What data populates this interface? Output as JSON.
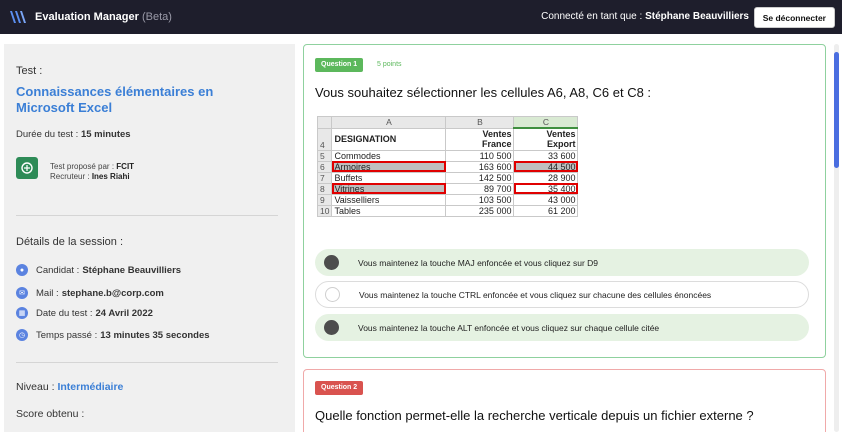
{
  "header": {
    "app_name": "Evaluation Manager",
    "app_beta": "(Beta)",
    "connected_prefix": "Connecté en tant que :",
    "connected_user": "Stéphane Beauvilliers",
    "logout_label": "Se déconnecter",
    "logo_icon": "double-chevron-logo-icon",
    "bg_color": "#1e1e2c"
  },
  "sidebar": {
    "test_label": "Test :",
    "test_title": "Connaissances élémentaires en Microsoft Excel",
    "duration_label": "Durée du test :",
    "duration_value": "15 minutes",
    "proposed_by_label": "Test proposé par :",
    "proposed_by_value": "FCIT",
    "recruiter_label": "Recruteur :",
    "recruiter_value": "Ines Riahi",
    "session_label": "Détails de la session :",
    "candidate_label": "Candidat :",
    "candidate_value": "Stéphane Beauvilliers",
    "mail_label": "Mail :",
    "mail_value": "stephane.b@corp.com",
    "date_label": "Date du test :",
    "date_value": "24 Avril 2022",
    "time_label": "Temps passé :",
    "time_value": "13 minutes 35 secondes",
    "level_label": "Niveau :",
    "level_value": "Intermédiaire",
    "score_label": "Score obtenu :",
    "accent_color": "#3b7fd6"
  },
  "question1": {
    "badge": "Question 1",
    "points": "5 points",
    "text": "Vous souhaitez sélectionner les cellules A6, A8, C6 et C8 :",
    "sheet": {
      "col_headers": [
        "A",
        "B",
        "C"
      ],
      "header_row_num": "4",
      "header_a": "DESIGNATION",
      "header_b_1": "Ventes",
      "header_b_2": "France",
      "header_c_1": "Ventes",
      "header_c_2": "Export",
      "rows": [
        {
          "num": "5",
          "a": "Commodes",
          "b": "110 500",
          "c": "33 600"
        },
        {
          "num": "6",
          "a": "Armoires",
          "b": "163 600",
          "c": "44 500"
        },
        {
          "num": "7",
          "a": "Buffets",
          "b": "142 500",
          "c": "28 900"
        },
        {
          "num": "8",
          "a": "Vitrines",
          "b": "89 700",
          "c": "35 400"
        },
        {
          "num": "9",
          "a": "Vaisselliers",
          "b": "103 500",
          "c": "43 000"
        },
        {
          "num": "10",
          "a": "Tables",
          "b": "235 000",
          "c": "61 200"
        }
      ]
    },
    "answers": [
      {
        "text": "Vous maintenez la touche MAJ enfoncée et vous cliquez sur D9",
        "selected": true
      },
      {
        "text": "Vous maintenez la touche CTRL enfoncée et vous cliquez sur chacune des cellules énoncées",
        "selected": false
      },
      {
        "text": "Vous maintenez la touche ALT enfoncée et vous cliquez sur chaque cellule citée",
        "selected": true
      }
    ],
    "accent_color": "#5cb85c"
  },
  "question2": {
    "badge": "Question 2",
    "text": "Quelle fonction permet-elle la recherche verticale depuis un fichier externe ?",
    "accent_color": "#d9534f"
  }
}
